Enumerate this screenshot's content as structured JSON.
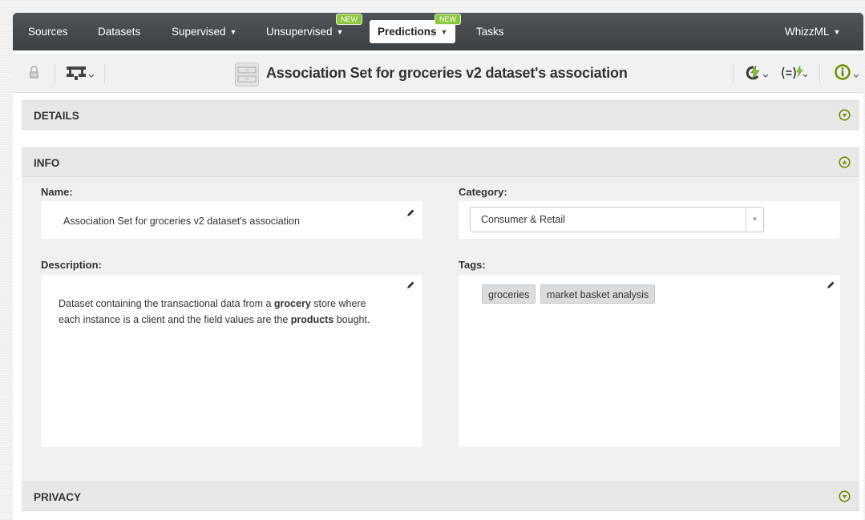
{
  "nav": {
    "sources": "Sources",
    "datasets": "Datasets",
    "supervised": "Supervised",
    "unsupervised": "Unsupervised",
    "predictions": "Predictions",
    "tasks": "Tasks",
    "whizzml": "WhizzML",
    "new_badge": "NEW"
  },
  "toolbar": {
    "title": "Association Set for groceries v2 dataset's association",
    "icons": [
      "lock-icon",
      "dag-tree-icon",
      "association-set-icon",
      "refresh-lightning-icon",
      "formula-lightning-icon",
      "info-circle-icon"
    ]
  },
  "panels": {
    "details": "DETAILS",
    "info": "INFO",
    "privacy": "PRIVACY"
  },
  "info": {
    "name_label": "Name:",
    "name_value": "Association Set for groceries v2 dataset's association",
    "category_label": "Category:",
    "category_value": "Consumer & Retail",
    "description_label": "Description:",
    "description": {
      "line1_prefix": "Dataset containing the transactional data from a ",
      "line1_bold": "grocery",
      "line1_suffix": " store where",
      "line2_prefix": "each instance is a client and the field values are the ",
      "line2_bold": "products",
      "line2_suffix": " bought."
    },
    "tags_label": "Tags:",
    "tags": [
      "groceries",
      "market basket analysis"
    ]
  },
  "colors": {
    "nav_bg": "#3f4448",
    "badge_green": "#8dc63f",
    "accent_olive": "#6b8e00",
    "lightning_green": "#8dc63f"
  }
}
